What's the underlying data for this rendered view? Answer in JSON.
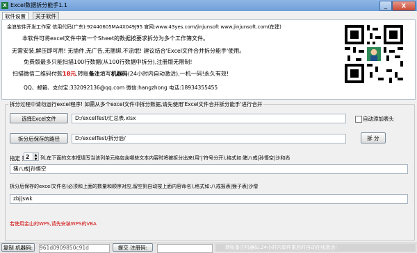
{
  "window": {
    "title": "Excel数据拆分能手1.1",
    "app_icon": "excel-icon",
    "min_label": "_",
    "close_label": "X"
  },
  "tabs": [
    {
      "label": "软件设置",
      "active": true
    },
    {
      "label": "关于软件",
      "active": false
    }
  ],
  "info": {
    "company_line": "金浪软件开发工作室 信用代码(广东):92440605MA4X049J95 官网:www.43yes.com/jinjunsoft www.jinjunsoft.com(在建)",
    "desc1": "本软件可将excel文件中第一个Sheet的数据按要求拆分为多个工作簿文件。",
    "desc2": "无需安装,解压即可用! 无插件,无广告,无捆绑,不流氓! 建议结合'Excel文件合并拆分能手'使用。",
    "desc3": "免费版最多只能扫描100行数据(从100行数据中拆分),注册版无限制!",
    "desc4_a": "扫描微信二维码付款",
    "desc4_price": "18元",
    "desc4_b": ",转账",
    "desc4_note": "备注",
    "desc4_c": "填写",
    "desc4_machine": "机器码",
    "desc4_d": "(24小时内自动激活),一机一码!永久有效!",
    "contact": "QQ、邮箱、支付宝:332092136@qq.com      微信:hangzhong      电话:18934355455",
    "qr_icon": "wechat-pay-qr-icon"
  },
  "form": {
    "group_title": "拆分过程中请勿运行excel程序! 如需从多个excel文件中拆分数据,请先使用'Excel文件合并拆分能手'进行合并",
    "select_button": "选择Excel文件",
    "file_path": "D:/excelTest/汇总表.xlsx",
    "auto_header_label": "自动添加表头",
    "auto_header_checked": false,
    "save_path_button": "拆分后保存的路径",
    "save_path": "D:/excelTest/拆分后/",
    "split_button": "拆 分",
    "col_prefix": "指定 第",
    "col_value": "2",
    "col_suffix": "列,在下面的文本框填写当该列单元格包含哪些文本内容时将被拆分出来(用'|'符号分开),格式如:猪八戒|孙悟空|沙和尚",
    "match_text": "猪八戒|孙悟空",
    "naming_hint": "拆分后保存的excel文件名(必须和上面的数量和顺序对应,留空则自动按上面内容命名),格式如:八戒报表|猴子表|沙僧",
    "name_text": "zbj|swk",
    "wps_note": "若使用金山的WPS,请先安装WPS的VBA"
  },
  "statusbar": {
    "copy_button": "复制 机器码:",
    "machine_code": "961d0909850c91d",
    "submit_button": "提交 注册码:",
    "register_code": "",
    "note": "转账备注机器码,24小时内软件重启时自动在线激活!"
  }
}
